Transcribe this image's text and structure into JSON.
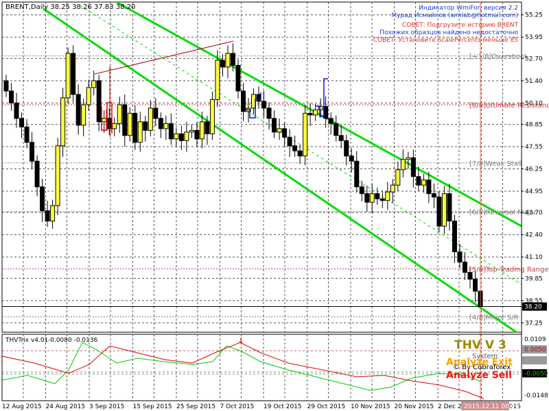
{
  "window": {
    "symbol_header": "BRENT,Daily  38.25 38.26 37.83 38.20"
  },
  "info_lines": [
    {
      "text": "Индикатор WmiFor, версия 2.2",
      "color": "#1e3cd2"
    },
    {
      "text": "Мурад Исмайлов (wmlab@hotmail.com)",
      "color": "#1e3cd2"
    },
    {
      "text": "СОВЕТ: Подгрузите историю BRENT",
      "color": "#e0302a"
    },
    {
      "text": "Похожих образцов найдено недостаточно",
      "color": "#1e3cd2"
    },
    {
      "text": "СОВЕТ: Установите ScalePercents меньше 85",
      "color": "#e0302a"
    }
  ],
  "murrey_labels": [
    {
      "text": "[+1/8]Overshoot",
      "price": 52.85
    },
    {
      "text": "[8/8]Ultimate Resistance",
      "price": 50.0
    },
    {
      "text": "[7/8]Weak Stall",
      "price": 46.6
    },
    {
      "text": "[6/8]Reversal Major",
      "price": 43.75
    },
    {
      "text": "[5/8]Top Trading Range",
      "price": 40.4
    },
    {
      "text": "[4/8]Major S/R",
      "price": 37.6
    }
  ],
  "colors": {
    "channel": "#00dd00",
    "grid": "#555555",
    "resistance_line": "#b00000",
    "pattern_red": "#e00000",
    "pattern_blue": "#1010d0",
    "cursor": "#d07050",
    "oscillator_green": "#00cc00",
    "oscillator_red": "#e00000",
    "thv_title": "#a08800",
    "analyze_exit": "#ffa000",
    "analyze_sell": "#ff1010"
  },
  "chart_data": {
    "type": "candlestick",
    "title": "BRENT,Daily  38.25 38.26 37.83 38.20",
    "y_axis": {
      "min": 36.7,
      "max": 56.0,
      "ticks": [
        55.25,
        53.95,
        52.7,
        51.4,
        50.1,
        48.85,
        47.55,
        46.25,
        44.95,
        43.7,
        42.4,
        41.1,
        39.85,
        38.55,
        37.25
      ],
      "last_price_label": "38.20",
      "last_price": 38.2
    },
    "x_axis": {
      "labels": [
        "12 Aug 2015",
        "24 Aug 2015",
        "3 Sep 2015",
        "15 Sep 2015",
        "25 Sep 2015",
        "7 Oct 2015",
        "19 Oct 2015",
        "29 Oct 2015",
        "10 Nov 2015",
        "20 Nov 2015",
        "2 Dec 2015",
        "15 Dec 2015"
      ],
      "cursor_date_label": "2015.12.11 00:00"
    },
    "candles_approx_close": [
      50.8,
      50.1,
      49.2,
      48.7,
      47.8,
      46.7,
      45.2,
      43.8,
      43.2,
      44.1,
      47.6,
      50.4,
      53.0,
      50.6,
      48.8,
      50.0,
      51.0,
      51.4,
      49.0,
      49.2,
      48.6,
      48.9,
      50.0,
      48.2,
      49.5,
      47.8,
      49.0,
      48.5,
      49.8,
      49.2,
      48.6,
      48.9,
      48.0,
      48.3,
      47.9,
      48.4,
      48.5,
      48.0,
      49.0,
      48.3,
      50.3,
      52.6,
      52.2,
      53.0,
      52.3,
      50.8,
      49.6,
      49.8,
      50.6,
      50.2,
      49.8,
      49.2,
      48.4,
      48.6,
      48.1,
      47.6,
      47.3,
      47.0,
      49.5,
      49.4,
      49.7,
      49.9,
      49.2,
      48.9,
      48.2,
      47.9,
      47.0,
      46.7,
      45.2,
      44.8,
      44.3,
      44.8,
      44.5,
      44.4,
      44.9,
      45.3,
      46.2,
      46.8,
      46.9,
      45.8,
      45.3,
      45.6,
      44.8,
      44.6,
      42.9,
      44.8,
      43.2,
      41.4,
      40.8,
      40.2,
      39.8,
      39.1,
      38.2
    ],
    "price_channel": {
      "upper": [
        {
          "x_frac": 0.22,
          "price": 56.0
        },
        {
          "x_frac": 1.0,
          "price": 42.9
        }
      ],
      "lower": [
        {
          "x_frac": 0.08,
          "price": 55.6
        },
        {
          "x_frac": 0.99,
          "price": 36.7
        }
      ]
    },
    "oscillator": {
      "name": "THVTrix v4.01",
      "values_text": "-0.0080 -0.0136",
      "ticks": [
        "0.0109",
        "-0.0148"
      ],
      "level_labels": [
        "0.0050",
        "-0.0050"
      ],
      "panel": {
        "title": "THV V 3",
        "line2": "System",
        "line3": "© By Cobraforex",
        "exit": "Analyze Exit",
        "sell": "Analyze Sell"
      }
    }
  }
}
